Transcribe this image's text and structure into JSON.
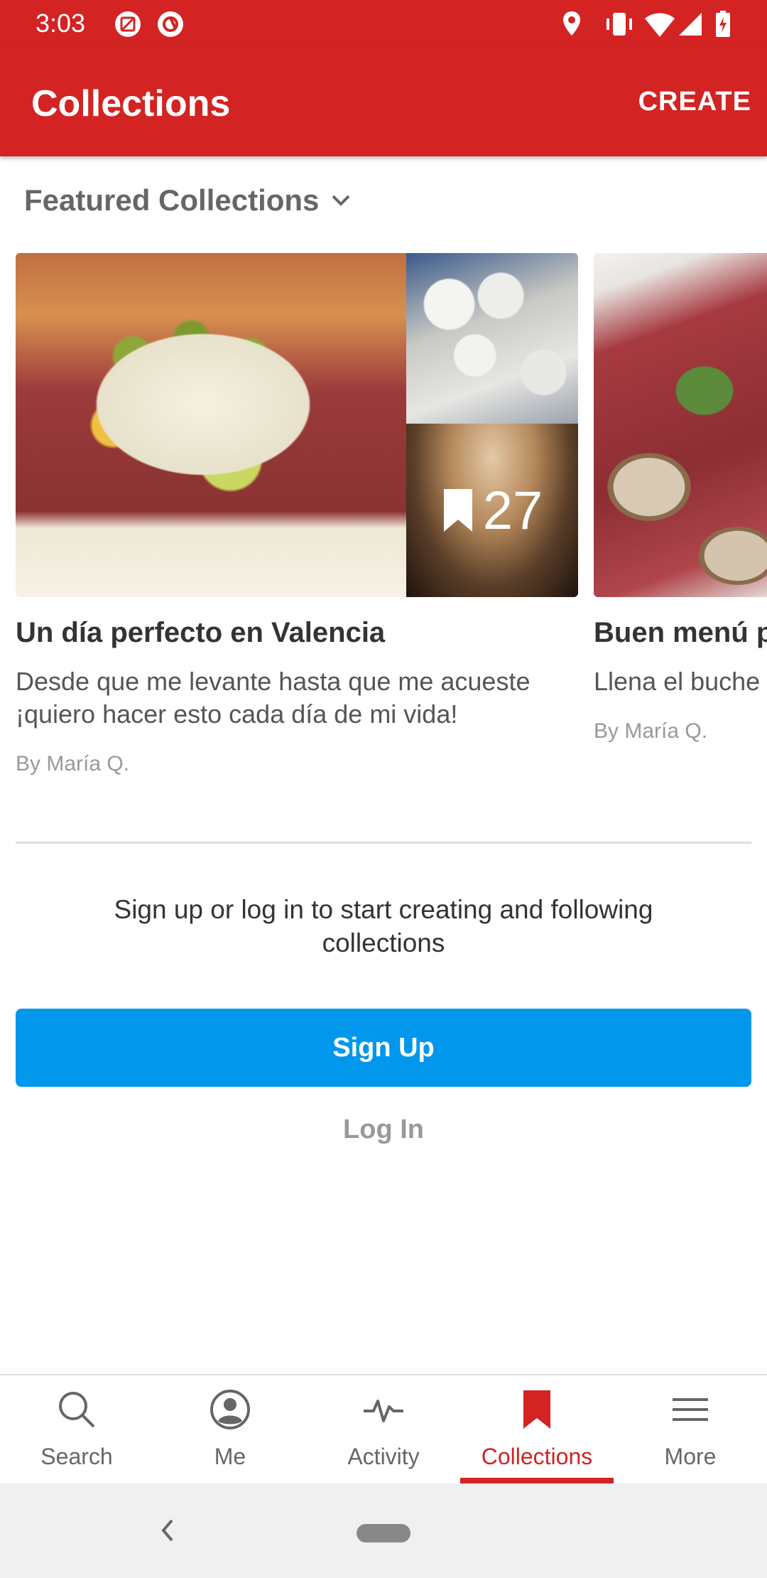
{
  "status_bar": {
    "time": "3:03"
  },
  "app_bar": {
    "title": "Collections",
    "action": "CREATE"
  },
  "featured": {
    "label": "Featured Collections"
  },
  "collections": [
    {
      "title": "Un día perfecto en Valencia",
      "description": "Desde que me levante hasta que me acueste ¡quiero hacer esto cada día de mi vida!",
      "author": "By María Q.",
      "count": "27"
    },
    {
      "title": "Buen menú p",
      "description": "Llena el buche",
      "author": "By María Q."
    }
  ],
  "signin": {
    "prompt": "Sign up or log in to start creating and following collections",
    "signup_label": "Sign Up",
    "login_label": "Log In"
  },
  "bottom_nav": {
    "items": [
      {
        "label": "Search",
        "icon": "search-icon"
      },
      {
        "label": "Me",
        "icon": "person-icon"
      },
      {
        "label": "Activity",
        "icon": "activity-icon"
      },
      {
        "label": "Collections",
        "icon": "bookmark-icon",
        "active": true
      },
      {
        "label": "More",
        "icon": "menu-icon"
      }
    ]
  },
  "colors": {
    "brand_red": "#d32323",
    "signup_blue": "#0097ec"
  }
}
